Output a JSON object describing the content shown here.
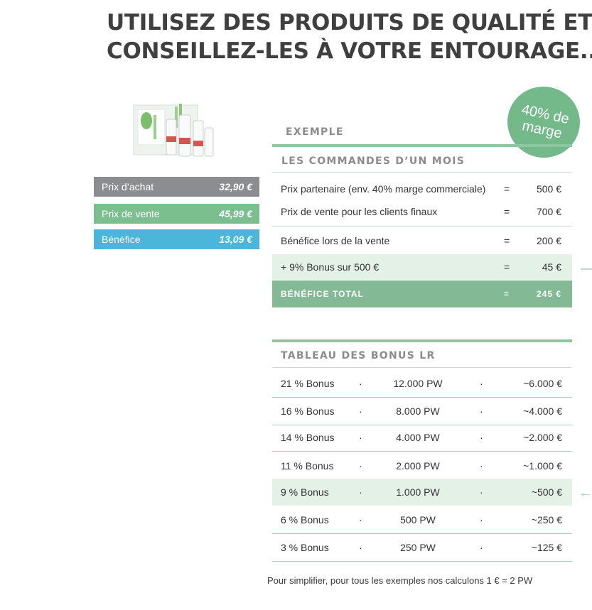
{
  "headline": {
    "line1": "UTILISEZ DES PRODUITS DE QUALITÉ ET",
    "line2": "CONSEILLEZ-LES À VOTRE ENTOURAGE..."
  },
  "product_image": "product-set",
  "prices": [
    {
      "label": "Prix d’achat",
      "value": "32,90 €",
      "color": "#8c8d90"
    },
    {
      "label": "Prix de vente",
      "value": "45,99 €",
      "color": "#7bbf8e"
    },
    {
      "label": "Bénéfice",
      "value": "13,09 €",
      "color": "#49b6da"
    }
  ],
  "badge": {
    "line1": "40% de",
    "line2": "marge"
  },
  "example": {
    "section_label": "EXEMPLE",
    "heading": "LES COMMANDES D’UN MOIS",
    "rows": [
      {
        "desc": "Prix partenaire (env. 40% marge commerciale)",
        "eq": "=",
        "value": "500 €"
      },
      {
        "desc": "Prix de vente pour les clients finaux",
        "eq": "=",
        "value": "700 €"
      },
      {
        "desc": "Bénéfice lors de la vente",
        "eq": "=",
        "value": "200 €"
      },
      {
        "desc": "+ 9% Bonus sur 500 €",
        "eq": "=",
        "value": "45 €"
      }
    ],
    "total": {
      "label": "BÉNÉFICE TOTAL",
      "eq": "=",
      "value": "245 €"
    }
  },
  "bonus_table": {
    "heading": "TABLEAU DES BONUS LR",
    "separator": "·",
    "rows": [
      {
        "percent": "21 % Bonus",
        "pw": "12.000 PW",
        "amount": "~6.000 €"
      },
      {
        "percent": "16 % Bonus",
        "pw": "8.000 PW",
        "amount": "~4.000 €"
      },
      {
        "percent": "14 % Bonus",
        "pw": "4.000 PW",
        "amount": "~2.000 €"
      },
      {
        "percent": "11 % Bonus",
        "pw": "2.000 PW",
        "amount": "~1.000 €"
      },
      {
        "percent": "9 % Bonus",
        "pw": "1.000 PW",
        "amount": "~500 €"
      },
      {
        "percent": "6 % Bonus",
        "pw": "500 PW",
        "amount": "~250 €"
      },
      {
        "percent": "3 % Bonus",
        "pw": "250 PW",
        "amount": "~125 €"
      }
    ],
    "arrow": "←"
  },
  "footnote": "Pour simplifier, pour tous les exemples nos calculons 1 € = 2 PW",
  "colors": {
    "accent_green": "#7bbf8e",
    "accent_blue": "#49b6da",
    "grey": "#8c8d90",
    "light_band": "#e3f1e7"
  }
}
